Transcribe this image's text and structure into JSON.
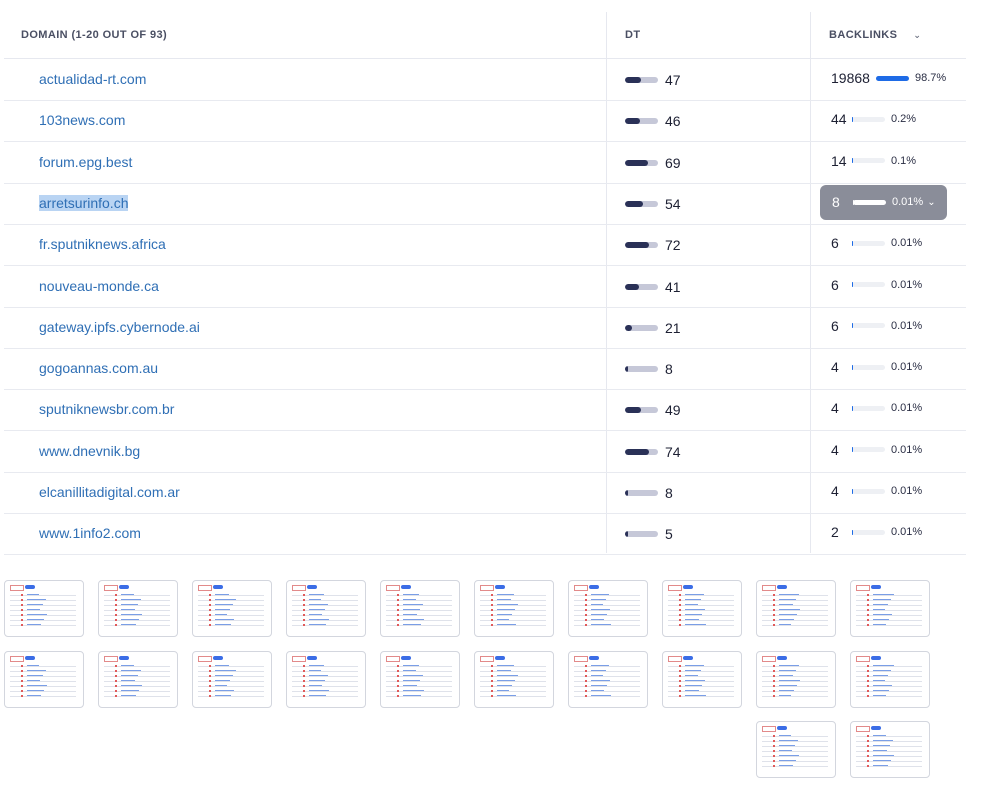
{
  "table": {
    "headers": {
      "domain": "DOMAIN (1-20 OUT OF 93)",
      "dt": "DT",
      "backlinks": "BACKLINKS",
      "sort_icon": "chevron-down-icon"
    },
    "rows": [
      {
        "domain": "actualidad-rt.com",
        "dt": 47,
        "dt_text": "47",
        "backlinks": "19868",
        "pct": "98.7%",
        "pct_value": 0.987
      },
      {
        "domain": "103news.com",
        "dt": 46,
        "dt_text": "46",
        "backlinks": "44",
        "pct": "0.2%",
        "pct_value": 0.002
      },
      {
        "domain": "forum.epg.best",
        "dt": 69,
        "dt_text": "69",
        "backlinks": "14",
        "pct": "0.1%",
        "pct_value": 0.001
      },
      {
        "domain": "arretsurinfo.ch",
        "dt": 54,
        "dt_text": "54",
        "backlinks": "8",
        "pct": "0.01%",
        "pct_value": 0.0001,
        "selected": true
      },
      {
        "domain": "fr.sputniknews.africa",
        "dt": 72,
        "dt_text": "72",
        "backlinks": "6",
        "pct": "0.01%",
        "pct_value": 0.0001
      },
      {
        "domain": "nouveau-monde.ca",
        "dt": 41,
        "dt_text": "41",
        "backlinks": "6",
        "pct": "0.01%",
        "pct_value": 0.0001
      },
      {
        "domain": "gateway.ipfs.cybernode.ai",
        "dt": 21,
        "dt_text": "21",
        "backlinks": "6",
        "pct": "0.01%",
        "pct_value": 0.0001
      },
      {
        "domain": "gogoannas.com.au",
        "dt": 8,
        "dt_text": "8",
        "backlinks": "4",
        "pct": "0.01%",
        "pct_value": 0.0001
      },
      {
        "domain": "sputniknewsbr.com.br",
        "dt": 49,
        "dt_text": "49",
        "backlinks": "4",
        "pct": "0.01%",
        "pct_value": 0.0001
      },
      {
        "domain": "www.dnevnik.bg",
        "dt": 74,
        "dt_text": "74",
        "backlinks": "4",
        "pct": "0.01%",
        "pct_value": 0.0001
      },
      {
        "domain": "elcanillitadigital.com.ar",
        "dt": 8,
        "dt_text": "8",
        "backlinks": "4",
        "pct": "0.01%",
        "pct_value": 0.0001
      },
      {
        "domain": "www.1info2.com",
        "dt": 5,
        "dt_text": "5",
        "backlinks": "2",
        "pct": "0.01%",
        "pct_value": 0.0001
      }
    ]
  },
  "colors": {
    "domain_link": "#2f6fb5",
    "dt_fill": "#2a3157",
    "dt_track": "#c6c8d8",
    "backlink_fill": "#1e6be6",
    "selection": "#b9d4f3",
    "pill": "#8a8d99"
  },
  "thumbnails": {
    "count": 22,
    "icon": "page-thumbnail-icon"
  }
}
